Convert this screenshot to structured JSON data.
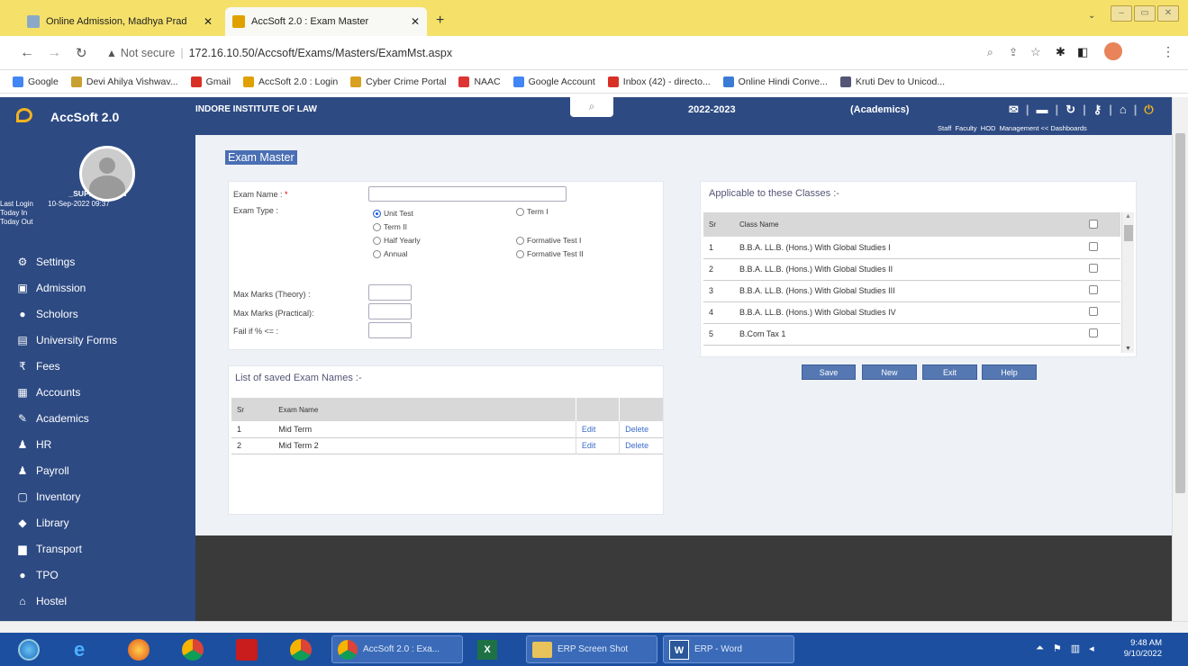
{
  "browser": {
    "tabs": [
      {
        "label": "Online Admission, Madhya Prad"
      },
      {
        "label": "AccSoft 2.0 : Exam Master"
      }
    ],
    "not_secure": "Not secure",
    "url": "172.16.10.50/Accsoft/Exams/Masters/ExamMst.aspx",
    "bookmarks": [
      {
        "label": "Google",
        "color": "#4285f4"
      },
      {
        "label": "Devi Ahilya Vishwav...",
        "color": "#c8a030"
      },
      {
        "label": "Gmail",
        "color": "#d93025"
      },
      {
        "label": "AccSoft 2.0 : Login",
        "color": "#e0a000"
      },
      {
        "label": "Cyber Crime Portal",
        "color": "#d8a020"
      },
      {
        "label": "NAAC",
        "color": "#d33"
      },
      {
        "label": "Google Account",
        "color": "#4285f4"
      },
      {
        "label": "Inbox (42) - directo...",
        "color": "#d93025"
      },
      {
        "label": "Online Hindi Conve...",
        "color": "#3a7bd5"
      },
      {
        "label": "Kruti Dev to Unicod...",
        "color": "#557"
      }
    ]
  },
  "app": {
    "name": "AccSoft 2.0",
    "institute": "INDORE INSTITUTE OF LAW",
    "session": "2022-2023",
    "module": "(Academics)",
    "header_links": "Staff  Faculty  HOD  Management << Dashboards"
  },
  "user": {
    "name": "_SUPER ADMIN",
    "last_login_label": "Last Login",
    "last_login_value": "10-Sep-2022 09:37",
    "today_in": "Today In",
    "today_out": "Today Out"
  },
  "nav": [
    {
      "label": "Settings",
      "icon": "gear-icon",
      "glyph": "⚙"
    },
    {
      "label": "Admission",
      "icon": "admission-icon",
      "glyph": "▣"
    },
    {
      "label": "Scholors",
      "icon": "person-icon",
      "glyph": "●"
    },
    {
      "label": "University Forms",
      "icon": "form-icon",
      "glyph": "▤"
    },
    {
      "label": "Fees",
      "icon": "rupee-icon",
      "glyph": "₹"
    },
    {
      "label": "Accounts",
      "icon": "calculator-icon",
      "glyph": "▦"
    },
    {
      "label": "Academics",
      "icon": "pencil-icon",
      "glyph": "✎"
    },
    {
      "label": "HR",
      "icon": "people-icon",
      "glyph": "♟"
    },
    {
      "label": "Payroll",
      "icon": "people-icon",
      "glyph": "♟"
    },
    {
      "label": "Inventory",
      "icon": "box-icon",
      "glyph": "▢"
    },
    {
      "label": "Library",
      "icon": "books-icon",
      "glyph": "◆"
    },
    {
      "label": "Transport",
      "icon": "bus-icon",
      "glyph": "▆"
    },
    {
      "label": "TPO",
      "icon": "person-icon",
      "glyph": "●"
    },
    {
      "label": "Hostel",
      "icon": "home-icon",
      "glyph": "⌂"
    }
  ],
  "page": {
    "title": "Exam Master",
    "exam_name_label": "Exam Name :",
    "required_mark": "*",
    "exam_type_label": "Exam Type :",
    "exam_types": [
      "Unit Test",
      "Term I",
      "Term II",
      "Half Yearly",
      "Formative Test I",
      "Annual",
      "Formative Test II"
    ],
    "selected_exam_type": "Unit Test",
    "max_theory_label": "Max Marks (Theory) :",
    "max_practical_label": "Max Marks (Practical):",
    "fail_label": "Fail if % <= :",
    "saved_list_title": "List of saved Exam Names :-",
    "saved_headers": [
      "Sr",
      "Exam Name"
    ],
    "saved_rows": [
      {
        "sr": "1",
        "name": "Mid Term",
        "edit": "Edit",
        "delete": "Delete"
      },
      {
        "sr": "2",
        "name": "Mid Term 2",
        "edit": "Edit",
        "delete": "Delete"
      }
    ],
    "classes_title": "Applicable to these Classes :-",
    "class_headers": [
      "Sr",
      "Class Name"
    ],
    "class_rows": [
      {
        "sr": "1",
        "name": "B.B.A. LL.B. (Hons.) With Global Studies I"
      },
      {
        "sr": "2",
        "name": "B.B.A. LL.B. (Hons.) With Global Studies II"
      },
      {
        "sr": "3",
        "name": "B.B.A. LL.B. (Hons.) With Global Studies III"
      },
      {
        "sr": "4",
        "name": "B.B.A. LL.B. (Hons.) With Global Studies IV"
      },
      {
        "sr": "5",
        "name": "B.Com Tax 1"
      }
    ],
    "buttons": [
      "Save",
      "New",
      "Exit",
      "Help"
    ]
  },
  "taskbar": {
    "apps": [
      "AccSoft 2.0 : Exa...",
      "ERP Screen Shot",
      "ERP - Word"
    ],
    "time": "9:48 AM",
    "date": "9/10/2022"
  }
}
